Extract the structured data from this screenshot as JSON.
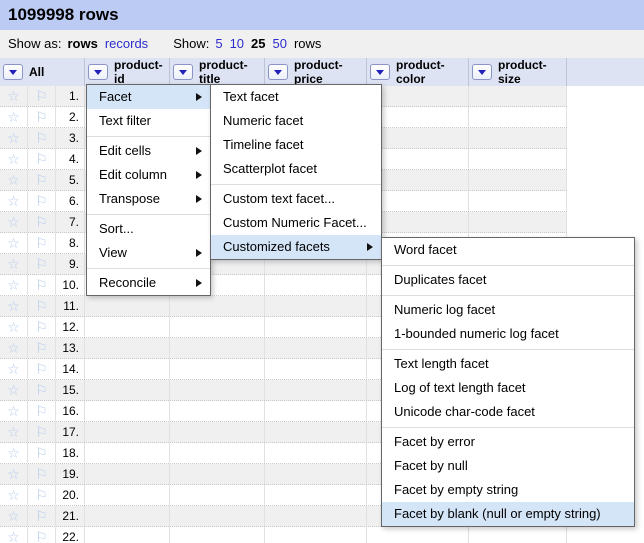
{
  "title": "1099998 rows",
  "toolbar": {
    "show_as_label": "Show as:",
    "show_as_options": [
      {
        "label": "rows",
        "active": true
      },
      {
        "label": "records",
        "active": false
      }
    ],
    "show_label": "Show:",
    "page_sizes": [
      {
        "label": "5",
        "active": false
      },
      {
        "label": "10",
        "active": false
      },
      {
        "label": "25",
        "active": true
      },
      {
        "label": "50",
        "active": false
      }
    ],
    "rows_suffix": "rows"
  },
  "table": {
    "columns": [
      {
        "label": "All"
      },
      {
        "label": "product-id"
      },
      {
        "label": "product-title"
      },
      {
        "label": "product-price"
      },
      {
        "label": "product-color"
      },
      {
        "label": "product-size"
      }
    ],
    "row_numbers": [
      "1.",
      "2.",
      "3.",
      "4.",
      "5.",
      "6.",
      "7.",
      "8.",
      "9.",
      "10.",
      "11.",
      "12.",
      "13.",
      "14.",
      "15.",
      "16.",
      "17.",
      "18.",
      "19.",
      "20.",
      "21.",
      "22."
    ],
    "icons": {
      "star": "☆",
      "flag": "⚐"
    }
  },
  "menus": {
    "column_menu": {
      "items": [
        {
          "type": "item",
          "label": "Facet",
          "submenu": true,
          "highlighted": true
        },
        {
          "type": "item",
          "label": "Text filter"
        },
        {
          "type": "separator"
        },
        {
          "type": "item",
          "label": "Edit cells",
          "submenu": true
        },
        {
          "type": "item",
          "label": "Edit column",
          "submenu": true
        },
        {
          "type": "item",
          "label": "Transpose",
          "submenu": true
        },
        {
          "type": "separator"
        },
        {
          "type": "item",
          "label": "Sort..."
        },
        {
          "type": "item",
          "label": "View",
          "submenu": true
        },
        {
          "type": "separator"
        },
        {
          "type": "item",
          "label": "Reconcile",
          "submenu": true
        }
      ]
    },
    "facet_submenu": {
      "items": [
        {
          "type": "item",
          "label": "Text facet"
        },
        {
          "type": "item",
          "label": "Numeric facet"
        },
        {
          "type": "item",
          "label": "Timeline facet"
        },
        {
          "type": "item",
          "label": "Scatterplot facet"
        },
        {
          "type": "separator"
        },
        {
          "type": "item",
          "label": "Custom text facet..."
        },
        {
          "type": "item",
          "label": "Custom Numeric Facet..."
        },
        {
          "type": "item",
          "label": "Customized facets",
          "submenu": true,
          "highlighted": true
        }
      ]
    },
    "customized_facets_submenu": {
      "items": [
        {
          "type": "item",
          "label": "Word facet"
        },
        {
          "type": "separator"
        },
        {
          "type": "item",
          "label": "Duplicates facet"
        },
        {
          "type": "separator"
        },
        {
          "type": "item",
          "label": "Numeric log facet"
        },
        {
          "type": "item",
          "label": "1-bounded numeric log facet"
        },
        {
          "type": "separator"
        },
        {
          "type": "item",
          "label": "Text length facet"
        },
        {
          "type": "item",
          "label": "Log of text length facet"
        },
        {
          "type": "item",
          "label": "Unicode char-code facet"
        },
        {
          "type": "separator"
        },
        {
          "type": "item",
          "label": "Facet by error"
        },
        {
          "type": "item",
          "label": "Facet by null"
        },
        {
          "type": "item",
          "label": "Facet by empty string"
        },
        {
          "type": "item",
          "label": "Facet by blank (null or empty string)",
          "highlighted": true
        }
      ]
    }
  },
  "colors": {
    "titlebar_bg": "#bccbf3",
    "toolbar_bg": "#f0f0f0",
    "header_bg": "#dde3f3",
    "row_alt_bg": "#f0f0f0",
    "highlight_bg": "#d5e5f8",
    "link": "#2d2dcc",
    "icon": "#b5ccec",
    "accent_blue": "#2222bb"
  }
}
